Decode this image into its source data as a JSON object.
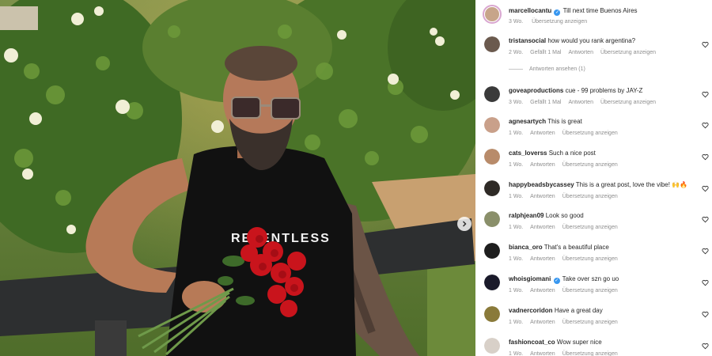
{
  "post": {
    "caption": {
      "username": "marcellocantu",
      "verified": true,
      "text": "Till next time Buenos Aires",
      "age": "3 Wo.",
      "translate": "Übersetzung anzeigen"
    },
    "shirt_text": "RELENTLESS",
    "next_icon": "chevron-right-icon"
  },
  "comments": [
    {
      "username": "tristansocial",
      "verified": false,
      "text": "how would you rank argentina?",
      "age": "2 Wo.",
      "likes": "Gefällt 1 Mal",
      "reply": "Antworten",
      "translate": "Übersetzung anzeigen",
      "avatar_color": "#6b5a4e"
    },
    {
      "username": "goveaproductions",
      "verified": false,
      "text": "cue - 99 problems by JAY-Z",
      "age": "3 Wo.",
      "likes": "Gefällt 1 Mal",
      "reply": "Antworten",
      "translate": "Übersetzung anzeigen",
      "avatar_color": "#3a3a3a"
    },
    {
      "username": "agnesartych",
      "verified": false,
      "text": "This is great",
      "age": "1 Wo.",
      "likes": "",
      "reply": "Antworten",
      "translate": "Übersetzung anzeigen",
      "avatar_color": "#c9a08a"
    },
    {
      "username": "cats_loverss",
      "verified": false,
      "text": "Such a nice post",
      "age": "1 Wo.",
      "likes": "",
      "reply": "Antworten",
      "translate": "Übersetzung anzeigen",
      "avatar_color": "#b88b6a"
    },
    {
      "username": "happybeadsbycassey",
      "verified": false,
      "text": "This is a great post, love the vibe! 🙌🔥",
      "age": "1 Wo.",
      "likes": "",
      "reply": "Antworten",
      "translate": "Übersetzung anzeigen",
      "avatar_color": "#2e2a26"
    },
    {
      "username": "ralphjean09",
      "verified": false,
      "text": "Look so good",
      "age": "1 Wo.",
      "likes": "",
      "reply": "Antworten",
      "translate": "Übersetzung anzeigen",
      "avatar_color": "#8a8f6a"
    },
    {
      "username": "bianca_oro",
      "verified": false,
      "text": "That's a beautiful place",
      "age": "1 Wo.",
      "likes": "",
      "reply": "Antworten",
      "translate": "Übersetzung anzeigen",
      "avatar_color": "#1e1e1e"
    },
    {
      "username": "whoisgiomani",
      "verified": true,
      "text": "Take over szn go uo",
      "age": "1 Wo.",
      "likes": "",
      "reply": "Antworten",
      "translate": "Übersetzung anzeigen",
      "avatar_color": "#1a1a2a"
    },
    {
      "username": "vadnercoridon",
      "verified": false,
      "text": "Have a great day",
      "age": "1 Wo.",
      "likes": "",
      "reply": "Antworten",
      "translate": "Übersetzung anzeigen",
      "avatar_color": "#8a7a3a"
    },
    {
      "username": "fashioncoat_co",
      "verified": false,
      "text": "Wow super nice",
      "age": "1 Wo.",
      "likes": "",
      "reply": "Antworten",
      "translate": "Übersetzung anzeigen",
      "avatar_color": "#d8d0c8"
    }
  ],
  "view_replies": "Antworten ansehen (1)",
  "icons": {
    "like": "heart-icon",
    "verified": "verified-badge-icon"
  }
}
